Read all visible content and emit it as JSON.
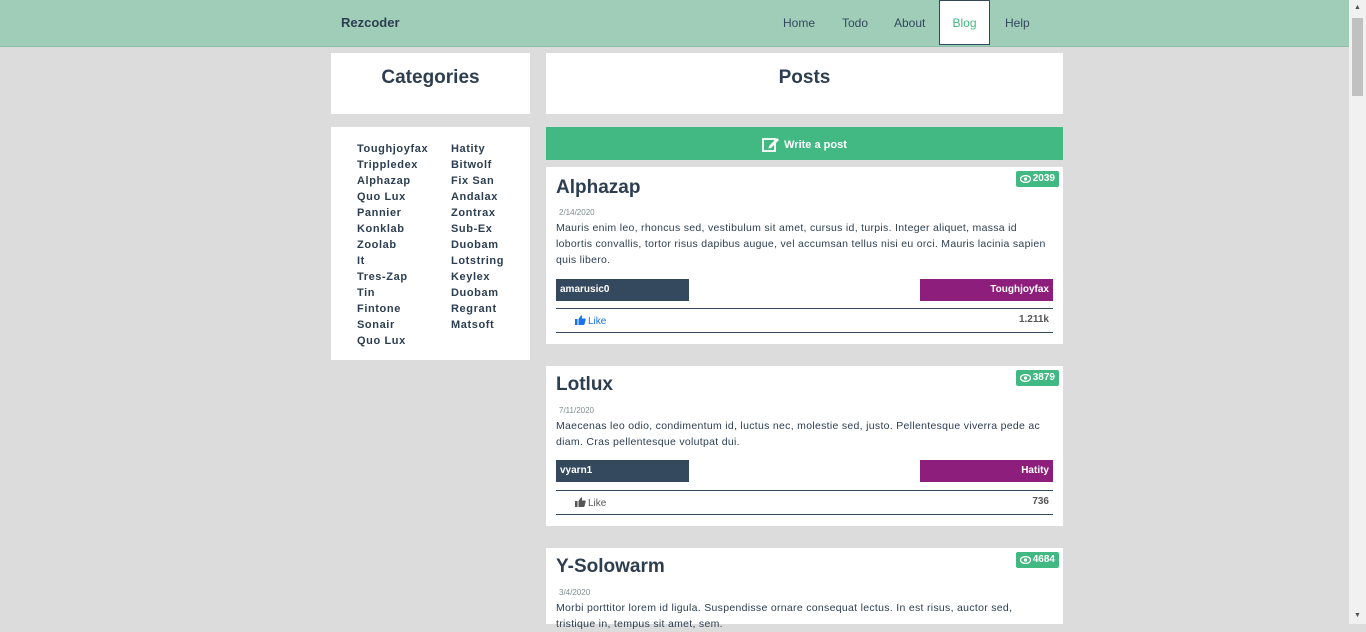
{
  "header": {
    "brand": "Rezcoder",
    "nav": [
      {
        "label": "Home"
      },
      {
        "label": "Todo"
      },
      {
        "label": "About"
      },
      {
        "label": "Blog",
        "active": true
      },
      {
        "label": "Help"
      }
    ]
  },
  "categories": {
    "title": "Categories",
    "column1": [
      "Toughjoyfax",
      "Trippledex",
      "Alphazap",
      "Quo Lux",
      "Pannier",
      "Konklab",
      "Zoolab",
      "It",
      "Tres-Zap",
      "Tin",
      "Fintone",
      "Sonair",
      "Quo Lux"
    ],
    "column2": [
      "Hatity",
      "Bitwolf",
      "Fix San",
      "Andalax",
      "Zontrax",
      "Sub-Ex",
      "Duobam",
      "Lotstring",
      "Keylex",
      "Duobam",
      "Regrant",
      "Matsoft"
    ]
  },
  "posts_panel": {
    "title": "Posts",
    "write_label": "Write a post"
  },
  "posts": [
    {
      "title": "Alphazap",
      "views": "2039",
      "date": "2/14/2020",
      "body": "Mauris enim leo, rhoncus sed, vestibulum sit amet, cursus id, turpis. Integer aliquet, massa id lobortis convallis, tortor risus dapibus augue, vel accumsan tellus nisi eu orci. Mauris lacinia sapien quis libero.",
      "author": "amarusic0",
      "category": "Toughjoyfax",
      "like_label": "Like",
      "likes": "1.211k",
      "liked": true
    },
    {
      "title": "Lotlux",
      "views": "3879",
      "date": "7/11/2020",
      "body": "Maecenas leo odio, condimentum id, luctus nec, molestie sed, justo. Pellentesque viverra pede ac diam. Cras pellentesque volutpat dui.",
      "author": "vyarn1",
      "category": "Hatity",
      "like_label": "Like",
      "likes": "736",
      "liked": false
    },
    {
      "title": "Y-Solowarm",
      "views": "4684",
      "date": "3/4/2020",
      "body": "Morbi porttitor lorem id ligula. Suspendisse ornare consequat lectus. In est risus, auctor sed, tristique in, tempus sit amet, sem."
    }
  ],
  "colors": {
    "accent": "#42b883",
    "header_bg": "#9fcdb8",
    "author_bg": "#34495e",
    "category_bg": "#8e1e7c",
    "text": "#2c3e50"
  }
}
